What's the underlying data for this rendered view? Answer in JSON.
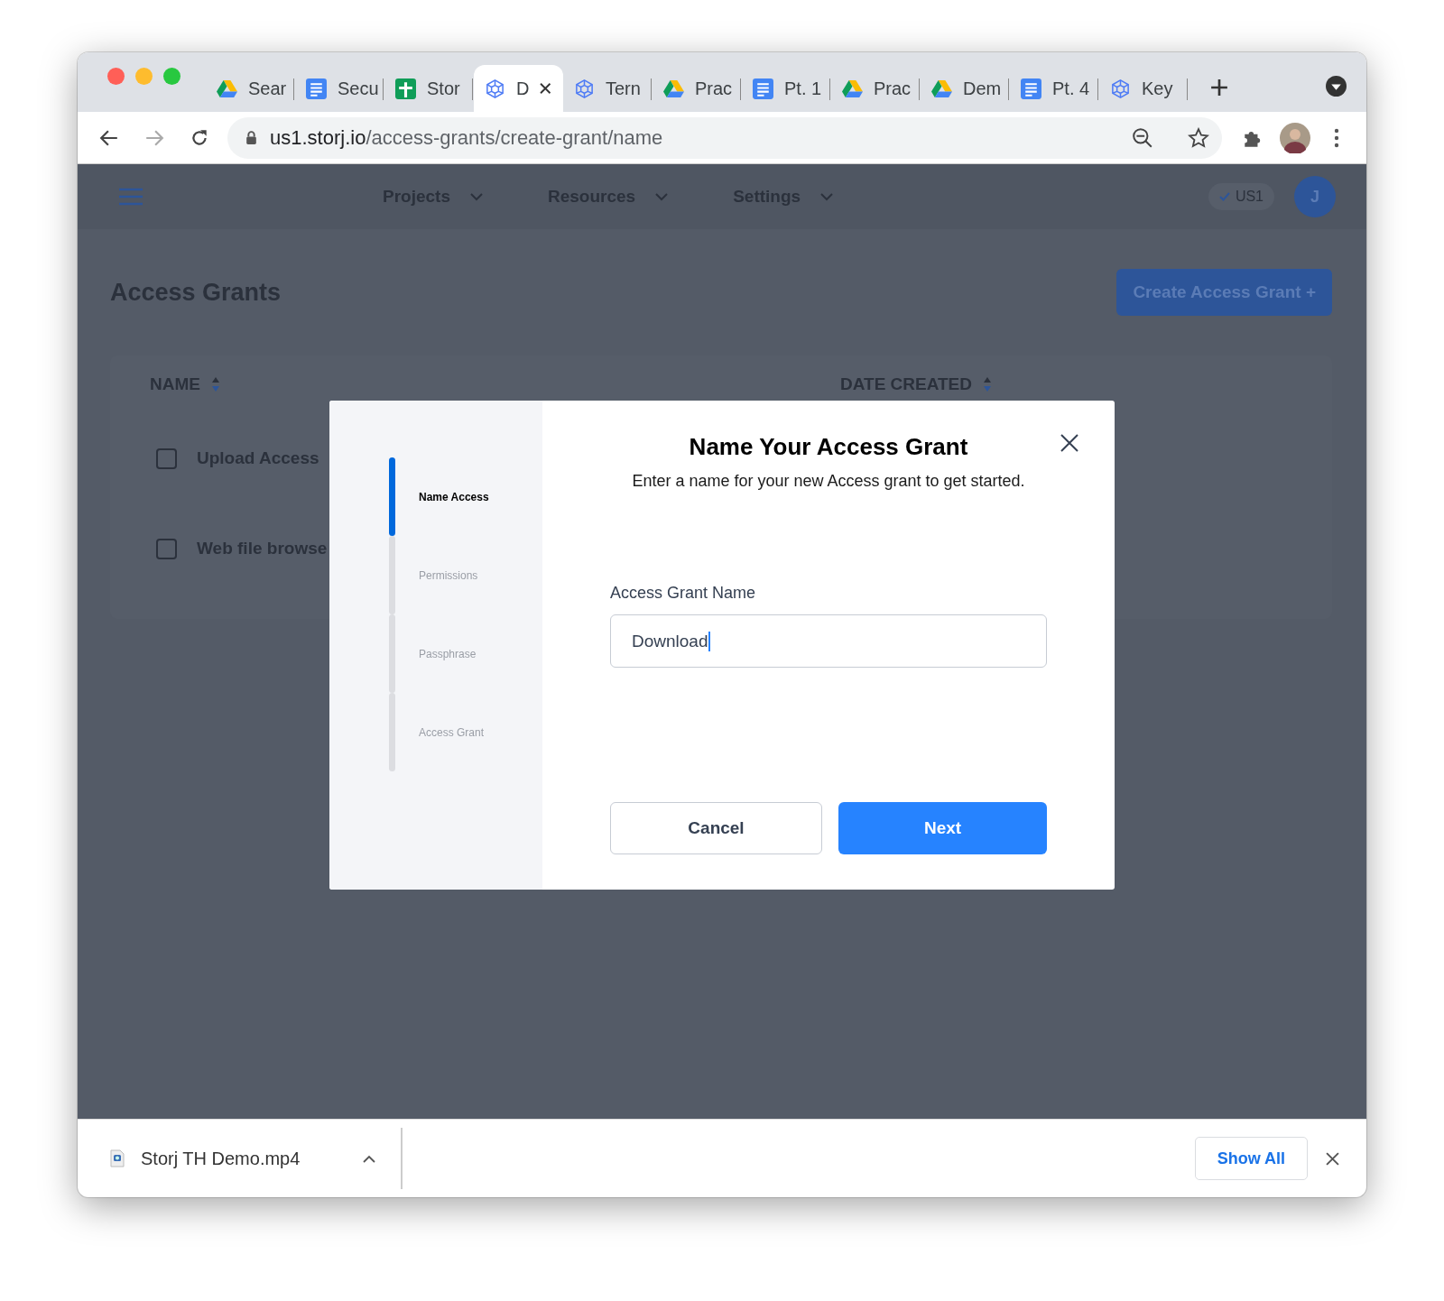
{
  "browser": {
    "tabs": [
      {
        "title": "Sear",
        "kind": "drive",
        "selected": false
      },
      {
        "title": "Secu",
        "kind": "doc",
        "selected": false
      },
      {
        "title": "Stor",
        "kind": "sheet",
        "selected": false
      },
      {
        "title": "D",
        "kind": "hexagon",
        "selected": true
      },
      {
        "title": "Tern",
        "kind": "hexagon",
        "selected": false
      },
      {
        "title": "Prac",
        "kind": "drive",
        "selected": false
      },
      {
        "title": "Pt. 1",
        "kind": "doc",
        "selected": false
      },
      {
        "title": "Prac",
        "kind": "drive",
        "selected": false
      },
      {
        "title": "Dem",
        "kind": "drive",
        "selected": false
      },
      {
        "title": "Pt. 4",
        "kind": "doc",
        "selected": false
      },
      {
        "title": "Key",
        "kind": "hexagon",
        "selected": false
      }
    ],
    "url": {
      "host": "us1.storj.io",
      "path": "/access-grants/create-grant/name"
    }
  },
  "app": {
    "nav": [
      "Projects",
      "Resources",
      "Settings"
    ],
    "region": "US1",
    "avatar": "J",
    "page_title": "Access Grants",
    "create_button": "Create Access Grant +",
    "table": {
      "columns": [
        "NAME",
        "DATE CREATED"
      ],
      "rows": [
        {
          "name": "Upload Access",
          "checked": false
        },
        {
          "name": "Web file browse",
          "checked": false
        }
      ]
    }
  },
  "modal": {
    "steps": [
      {
        "label": "Name Access",
        "selected": true
      },
      {
        "label": "Permissions",
        "selected": false
      },
      {
        "label": "Passphrase",
        "selected": false
      },
      {
        "label": "Access Grant",
        "selected": false
      }
    ],
    "title": "Name Your Access Grant",
    "subtitle": "Enter a name for your new Access grant to get started.",
    "field_label": "Access Grant Name",
    "field_value": "Download",
    "buttons": [
      "Cancel",
      "Next"
    ]
  },
  "download_bar": {
    "file": "Storj TH Demo.mp4",
    "show_all": "Show All"
  }
}
